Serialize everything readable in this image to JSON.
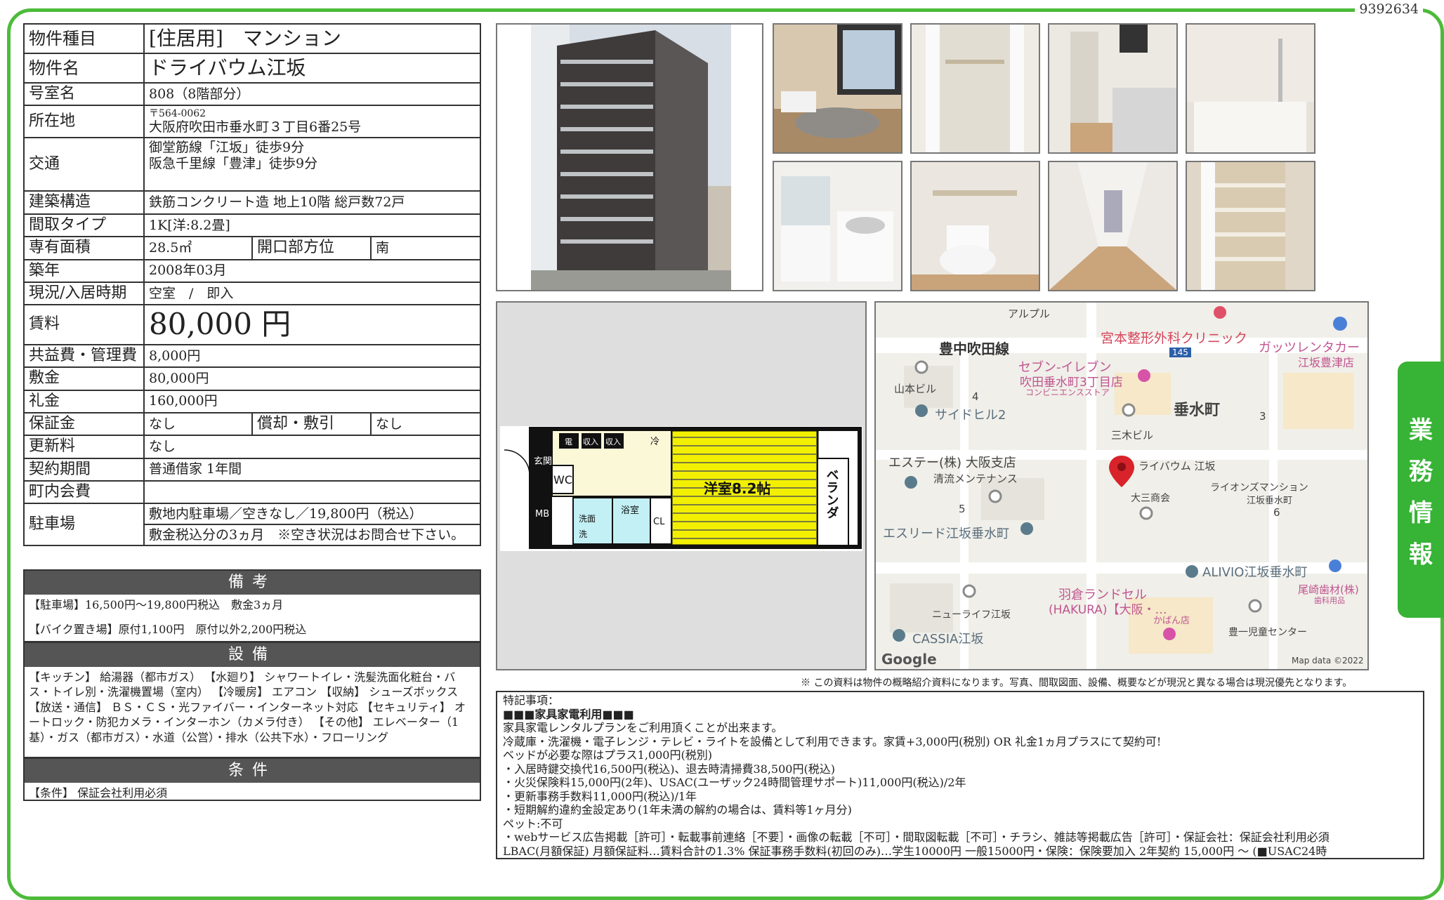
{
  "doc_id": "9392634",
  "side_tab": [
    "業",
    "務",
    "情",
    "報"
  ],
  "property": {
    "type_label": "物件種目",
    "type_value": "[住居用]　マンション",
    "name_label": "物件名",
    "name_value": "ドライバウム江坂",
    "room_label": "号室名",
    "room_value": "808（8階部分）",
    "address_label": "所在地",
    "postal": "〒564-0062",
    "address": "大阪府吹田市垂水町３丁目6番25号",
    "transport_label": "交通",
    "transport1": "御堂筋線「江坂」徒歩9分",
    "transport2": "阪急千里線「豊津」徒歩9分",
    "structure_label": "建築構造",
    "structure_value": "鉄筋コンクリート造 地上10階 総戸数72戸",
    "layout_label": "間取タイプ",
    "layout_value": "1K[洋:8.2畳]",
    "area_label": "専有面積",
    "area_value": "28.5㎡",
    "direction_label": "開口部方位",
    "direction_value": "南",
    "built_label": "築年",
    "built_value": "2008年03月",
    "status_label": "現況/入居時期",
    "status_value": "空室　/　即入",
    "rent_label": "賃料",
    "rent_value": "80,000 円",
    "fee_label": "共益費・管理費",
    "fee_value": "8,000円",
    "deposit_label": "敷金",
    "deposit_value": "80,000円",
    "keymoney_label": "礼金",
    "keymoney_value": "160,000円",
    "guarantee_label": "保証金",
    "guarantee_value": "なし",
    "amort_label": "償却・敷引",
    "amort_value": "なし",
    "renewal_label": "更新料",
    "renewal_value": "なし",
    "contract_label": "契約期間",
    "contract_value": "普通借家 1年間",
    "community_label": "町内会費",
    "community_value": "",
    "parking_label": "駐車場",
    "parking1": "敷地内駐車場／空きなし／19,800円（税込）",
    "parking2": "敷金税込分の3ヵ月　※空き状況はお問合せ下さい。"
  },
  "remarks": {
    "title": "備考",
    "line1": "【駐車場】16,500円～19,800円税込　敷金3ヵ月",
    "line2": "【バイク置き場】原付1,100円　原付以外2,200円税込"
  },
  "equipment": {
    "title": "設備",
    "text": "【キッチン】 給湯器（都市ガス） 【水廻り】 シャワートイレ・洗髪洗面化粧台・バス・トイレ別・洗濯機置場（室内） 【冷暖房】 エアコン 【収納】 シューズボックス 【放送・通信】 ＢＳ・ＣＳ・光ファイバー・インターネット対応 【セキュリティ】 オートロック・防犯カメラ・インターホン（カメラ付き） 【その他】 エレベーター（1基）・ガス（都市ガス）・水道（公営）・排水（公共下水）・フローリング"
  },
  "conditions": {
    "title": "条件",
    "text": "【条件】 保証会社利用必須"
  },
  "floorplan": {
    "room": "洋室8.2帖",
    "veranda": "ベランダ",
    "genkan": "玄関",
    "wc": "WC",
    "mb": "MB",
    "bath": "浴室",
    "wash": "洗面",
    "sentaku": "洗",
    "cl": "CL",
    "rei": "冷",
    "denki": "電",
    "shunyu1": "収入",
    "shunyu2": "収入"
  },
  "map": {
    "labels": [
      "アルプル",
      "宮本整形外科クリニック",
      "豊中吹田線",
      "145",
      "ガッツレンタカー",
      "江坂豊津店",
      "セブン-イレブン",
      "吹田垂水町3丁目店",
      "コンビニエンスストア",
      "山本ビル",
      "4",
      "サイドヒル2",
      "垂水町",
      "3",
      "三木ビル",
      "エステー(株) 大阪支店",
      "清流メンテナンス",
      "ライバウム 江坂",
      "ライオンズマンション",
      "江坂垂水町",
      "大三商会",
      "5",
      "6",
      "エスリード江坂垂水町",
      "ALIVIO江坂垂水町",
      "尾崎歯材(株)",
      "歯科用品",
      "羽倉ランドセル",
      "(HAKURA)【大阪・…",
      "かばん店",
      "ニューライフ江坂",
      "豊一児童センター",
      "CASSIA江坂",
      "Google",
      "Map data ©2022"
    ]
  },
  "notice": "※ この資料は物件の概略紹介資料になります。写真、間取図面、設備、概要などが現況と異なる場合は現況優先となります。",
  "special": {
    "lines": [
      "特記事項：",
      "■■■家具家電利用■■■",
      "家具家電レンタルプランをご利用頂くことが出来ます。",
      "冷蔵庫・洗濯機・電子レンジ・テレビ・ライトを設備として利用できます。家賃+3,000円(税別) OR 礼金1ヵ月プラスにて契約可!",
      "ベッドが必要な際はプラス1,000円(税別)",
      "・入居時鍵交換代16,500円(税込)、退去時清掃費38,500円(税込)",
      "・火災保険料15,000円(2年)、USAC(ユーザック24時間管理サポート)11,000円(税込)/2年",
      "・更新事務手数料11,000円(税込)/1年",
      "・短期解約違約金設定あり(1年未満の解約の場合は、賃料等1ヶ月分)",
      "ペット:不可",
      "・webサービス広告掲載［許可］・転載事前連絡［不要］・画像の転載［不可］・間取図転載［不可］・チラシ、雑誌等掲載広告［許可］・保証会社：保証会社利用必須",
      "LBAC(月額保証) 月額保証料…賃料合計の1.3% 保証事務手数料(初回のみ)…学生10000円 一般15000円・保険：保険要加入 2年契約 15,000円 〜 (■USAC24時"
    ]
  }
}
